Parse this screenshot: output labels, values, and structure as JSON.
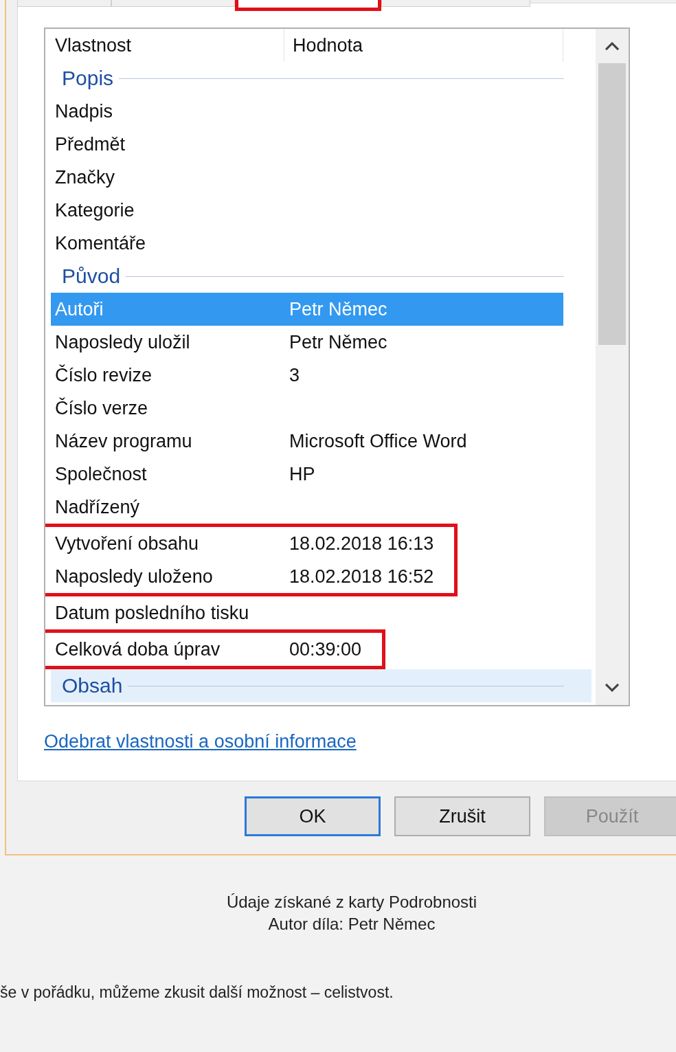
{
  "tabs": [
    {
      "selected": false,
      "framed": false
    },
    {
      "selected": false,
      "framed": false
    },
    {
      "selected": true,
      "framed": true
    },
    {
      "selected": false,
      "framed": false
    }
  ],
  "list": {
    "columns": [
      "Vlastnost",
      "Hodnota"
    ],
    "items": [
      {
        "kind": "group",
        "label": "Popis",
        "highlighted": false
      },
      {
        "kind": "row",
        "name": "Nadpis",
        "value": "",
        "selected": false
      },
      {
        "kind": "row",
        "name": "Předmět",
        "value": "",
        "selected": false
      },
      {
        "kind": "row",
        "name": "Značky",
        "value": "",
        "selected": false
      },
      {
        "kind": "row",
        "name": "Kategorie",
        "value": "",
        "selected": false
      },
      {
        "kind": "row",
        "name": "Komentáře",
        "value": "",
        "selected": false
      },
      {
        "kind": "group",
        "label": "Původ",
        "highlighted": false
      },
      {
        "kind": "row",
        "name": "Autoři",
        "value": "Petr Němec",
        "selected": true
      },
      {
        "kind": "row",
        "name": "Naposledy uložil",
        "value": "Petr Němec",
        "selected": false
      },
      {
        "kind": "row",
        "name": "Číslo revize",
        "value": "3",
        "selected": false
      },
      {
        "kind": "row",
        "name": "Číslo verze",
        "value": "",
        "selected": false
      },
      {
        "kind": "row",
        "name": "Název programu",
        "value": "Microsoft Office Word",
        "selected": false
      },
      {
        "kind": "row",
        "name": "Společnost",
        "value": "HP",
        "selected": false
      },
      {
        "kind": "row",
        "name": "Nadřízený",
        "value": "",
        "selected": false
      },
      {
        "kind": "frame",
        "rows": [
          {
            "name": "Vytvoření obsahu",
            "value": "18.02.2018 16:13",
            "selected": false
          },
          {
            "name": "Naposledy uloženo",
            "value": "18.02.2018 16:52",
            "selected": false
          }
        ]
      },
      {
        "kind": "row",
        "name": "Datum posledního tisku",
        "value": "",
        "selected": false
      },
      {
        "kind": "frame",
        "rows": [
          {
            "name": "Celková doba úprav",
            "value": "00:39:00",
            "selected": false
          }
        ]
      },
      {
        "kind": "group",
        "label": "Obsah",
        "highlighted": true
      }
    ]
  },
  "link": "Odebrat vlastnosti a osobní informace",
  "buttons": [
    {
      "label": "OK",
      "default": true,
      "disabled": false
    },
    {
      "label": "Zrušit",
      "default": false,
      "disabled": false
    },
    {
      "label": "Použít",
      "default": false,
      "disabled": true
    }
  ],
  "caption": [
    "Údaje získané z karty Podrobnosti",
    "Autor díla: Petr Němec"
  ],
  "body_text": "še v pořádku, můžeme zkusit další možnost – celistvost."
}
